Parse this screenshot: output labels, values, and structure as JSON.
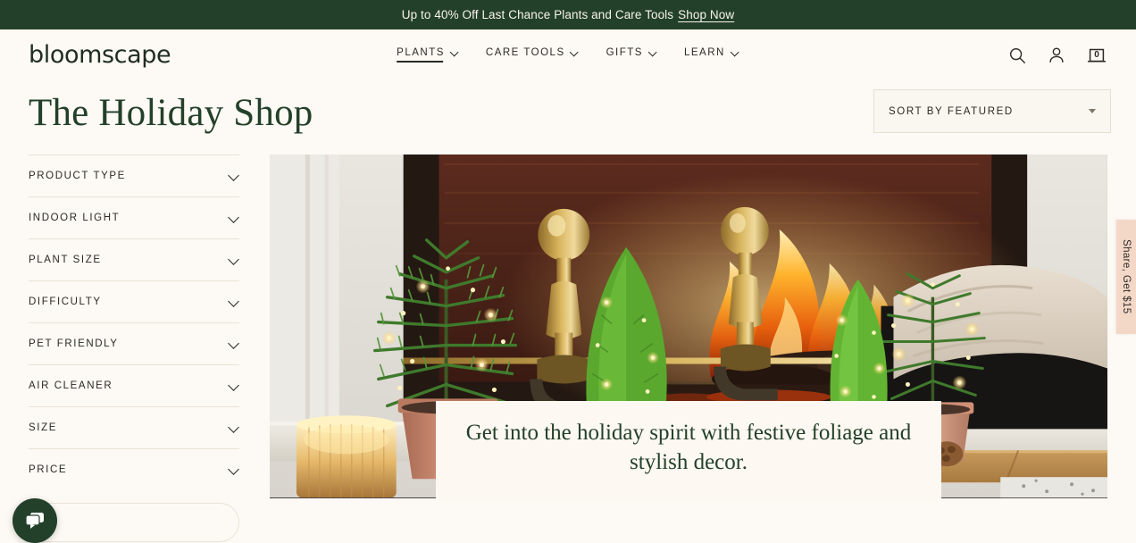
{
  "promo": {
    "text": "Up to 40% Off Last Chance Plants and Care Tools",
    "link_label": "Shop Now",
    "background": "#23402a",
    "text_color": "#f7f4ec"
  },
  "header": {
    "logo": "bloomscape",
    "nav": [
      {
        "label": "PLANTS",
        "icon": "chevron-down-icon",
        "active": true
      },
      {
        "label": "CARE TOOLS",
        "icon": "chevron-down-icon",
        "active": false
      },
      {
        "label": "GIFTS",
        "icon": "chevron-down-icon",
        "active": false
      },
      {
        "label": "LEARN",
        "icon": "chevron-down-icon",
        "active": false
      }
    ],
    "icons": {
      "search": "search-icon",
      "account": "user-account-icon",
      "cart": "shopping-bag-icon"
    },
    "cart_count": "0"
  },
  "page": {
    "title": "The Holiday Shop",
    "title_color": "#23402a",
    "background": "#fdf9f4"
  },
  "sort": {
    "label": "SORT BY FEATURED",
    "icon": "caret-down-icon"
  },
  "filters": {
    "items": [
      {
        "label": "PRODUCT TYPE",
        "icon": "chevron-down-icon"
      },
      {
        "label": "INDOOR LIGHT",
        "icon": "chevron-down-icon"
      },
      {
        "label": "PLANT SIZE",
        "icon": "chevron-down-icon"
      },
      {
        "label": "DIFFICULTY",
        "icon": "chevron-down-icon"
      },
      {
        "label": "PET FRIENDLY",
        "icon": "chevron-down-icon"
      },
      {
        "label": "AIR CLEANER",
        "icon": "chevron-down-icon"
      },
      {
        "label": "SIZE",
        "icon": "chevron-down-icon"
      },
      {
        "label": "PRICE",
        "icon": "chevron-down-icon"
      }
    ]
  },
  "hero": {
    "caption": "Get into the holiday spirit with festive foliage and stylish decor.",
    "alt": "Holiday plants in terracotta pots with fairy lights in front of a lit fireplace with brass andirons and pinecones"
  },
  "share_tab": {
    "label": "Share, Get $15",
    "background": "#f3d8c8"
  },
  "chat": {
    "icon": "chat-bubble-icon",
    "background": "#23402a"
  }
}
